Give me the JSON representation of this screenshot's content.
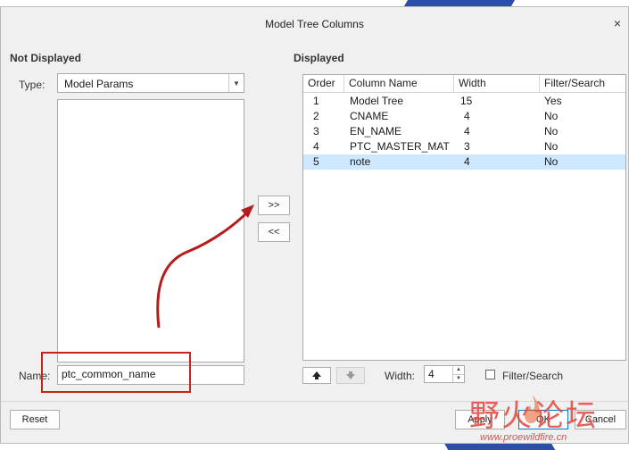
{
  "window": {
    "title": "Model Tree Columns",
    "close_glyph": "×"
  },
  "left": {
    "section_label": "Not Displayed",
    "type_label": "Type:",
    "type_value": "Model Params",
    "name_label": "Name:",
    "name_value": "ptc_common_name"
  },
  "transfer": {
    "add_label": ">>",
    "remove_label": "<<"
  },
  "right": {
    "section_label": "Displayed",
    "columns": [
      "Order",
      "Column Name",
      "Width",
      "Filter/Search"
    ],
    "rows": [
      {
        "order": "1",
        "name": "Model Tree",
        "width": "15",
        "filter": "Yes"
      },
      {
        "order": "2",
        "name": "CNAME",
        "width": "4",
        "filter": "No"
      },
      {
        "order": "3",
        "name": "EN_NAME",
        "width": "4",
        "filter": "No"
      },
      {
        "order": "4",
        "name": "PTC_MASTER_MATERIAL",
        "width": "3",
        "filter": "No"
      },
      {
        "order": "5",
        "name": "note",
        "width": "4",
        "filter": "No"
      }
    ],
    "selected_row": "5",
    "width_label": "Width:",
    "width_value": "4",
    "filter_label": "Filter/Search"
  },
  "footer": {
    "reset_label": "Reset",
    "apply_label": "Apply",
    "ok_label": "OK",
    "cancel_label": "Cancel"
  },
  "watermark": {
    "text": "野火论坛",
    "url": "www.proewildfire.cn"
  },
  "colors": {
    "selection": "#cde8ff",
    "annotation_red": "#c9231d",
    "watermark_red": "#e0473c"
  }
}
